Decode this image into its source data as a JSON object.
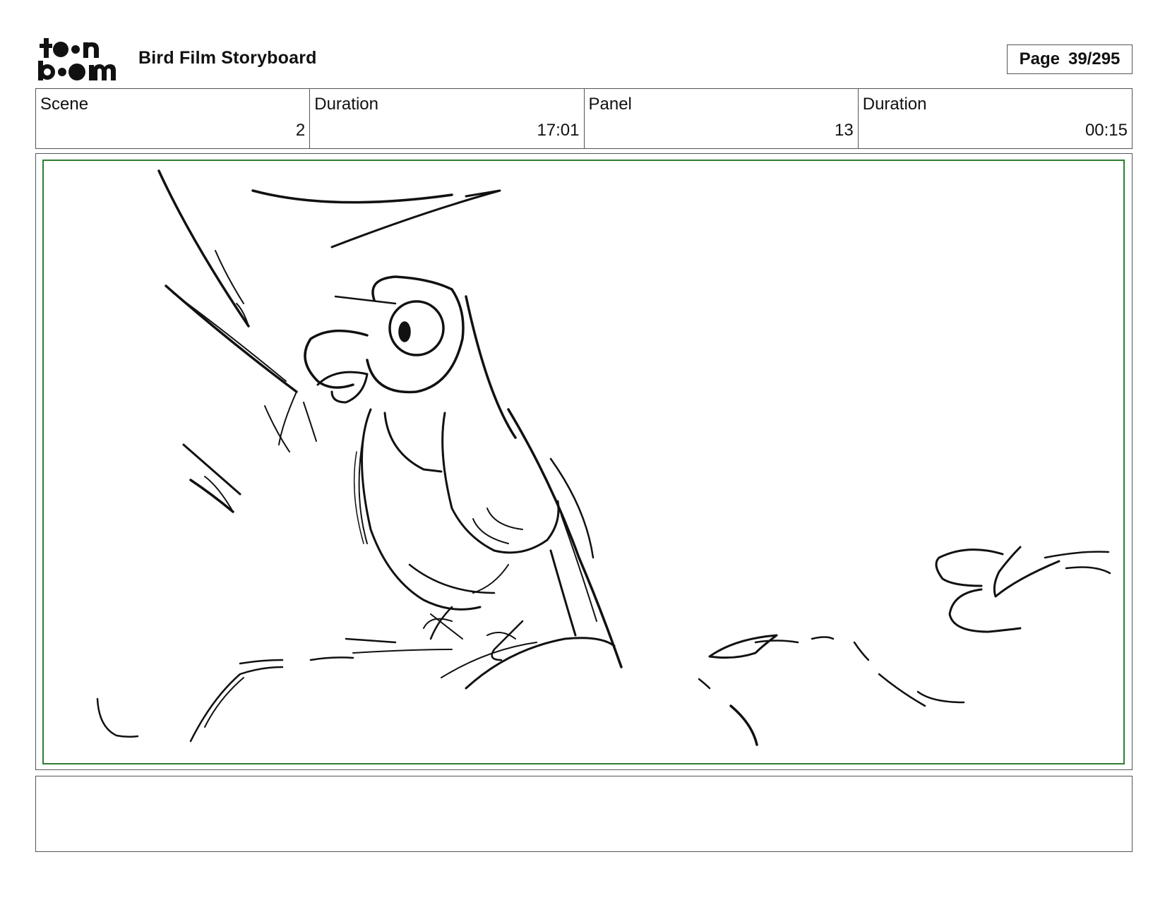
{
  "header": {
    "logo_text": "toon boom",
    "title": "Bird Film Storyboard",
    "page_label": "Page",
    "page_number": "39/295"
  },
  "info": {
    "scene_label": "Scene",
    "scene_value": "2",
    "scene_duration_label": "Duration",
    "scene_duration_value": "17:01",
    "panel_label": "Panel",
    "panel_value": "13",
    "panel_duration_label": "Duration",
    "panel_duration_value": "00:15"
  },
  "notes": {
    "text": ""
  },
  "colors": {
    "safe_area_border": "#2e7d32",
    "ink": "#111111"
  }
}
